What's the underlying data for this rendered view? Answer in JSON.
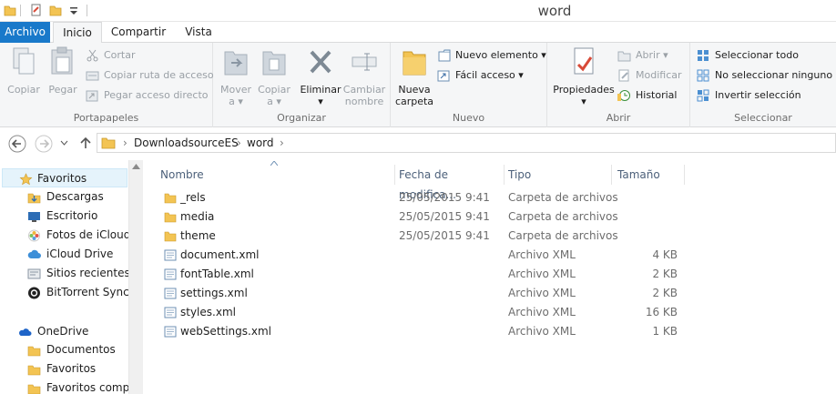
{
  "window": {
    "title": "word"
  },
  "ribbon_tabs": [
    "Archivo",
    "Inicio",
    "Compartir",
    "Vista"
  ],
  "ribbon": {
    "portapapeles": {
      "label": "Portapapeles",
      "copiar": "Copiar",
      "pegar": "Pegar",
      "cortar": "Cortar",
      "copiar_ruta": "Copiar ruta de acceso",
      "pegar_acceso": "Pegar acceso directo"
    },
    "organizar": {
      "label": "Organizar",
      "mover": "Mover",
      "mover2": "a",
      "copiar": "Copiar",
      "copiar2": "a",
      "eliminar": "Eliminar",
      "cambiar": "Cambiar",
      "cambiar2": "nombre"
    },
    "nuevo": {
      "label": "Nuevo",
      "nueva": "Nueva",
      "carpeta": "carpeta",
      "nuevo_elemento": "Nuevo elemento",
      "facil_acceso": "Fácil acceso"
    },
    "abrir": {
      "label": "Abrir",
      "propiedades": "Propiedades",
      "abrir": "Abrir",
      "modificar": "Modificar",
      "historial": "Historial"
    },
    "seleccionar": {
      "label": "Seleccionar",
      "todo": "Seleccionar todo",
      "ninguno": "No seleccionar ninguno",
      "invertir": "Invertir selección"
    }
  },
  "address": {
    "crumbs": [
      "DownloadsourceES",
      "word"
    ]
  },
  "nav": {
    "favoritos": "Favoritos",
    "items": [
      "Descargas",
      "Escritorio",
      "Fotos de iCloud",
      "iCloud Drive",
      "Sitios recientes",
      "BitTorrent Sync"
    ],
    "onedrive": "OneDrive",
    "onedrive_items": [
      "Documentos",
      "Favoritos",
      "Favoritos compa"
    ]
  },
  "columns": {
    "name": "Nombre",
    "date": "Fecha de modifica...",
    "type": "Tipo",
    "size": "Tamaño"
  },
  "files": [
    {
      "name": "_rels",
      "date": "25/05/2015 9:41",
      "type": "Carpeta de archivos",
      "size": "",
      "kind": "folder"
    },
    {
      "name": "media",
      "date": "25/05/2015 9:41",
      "type": "Carpeta de archivos",
      "size": "",
      "kind": "folder"
    },
    {
      "name": "theme",
      "date": "25/05/2015 9:41",
      "type": "Carpeta de archivos",
      "size": "",
      "kind": "folder"
    },
    {
      "name": "document.xml",
      "date": "",
      "type": "Archivo XML",
      "size": "4 KB",
      "kind": "xml"
    },
    {
      "name": "fontTable.xml",
      "date": "",
      "type": "Archivo XML",
      "size": "2 KB",
      "kind": "xml"
    },
    {
      "name": "settings.xml",
      "date": "",
      "type": "Archivo XML",
      "size": "2 KB",
      "kind": "xml"
    },
    {
      "name": "styles.xml",
      "date": "",
      "type": "Archivo XML",
      "size": "16 KB",
      "kind": "xml"
    },
    {
      "name": "webSettings.xml",
      "date": "",
      "type": "Archivo XML",
      "size": "1 KB",
      "kind": "xml"
    }
  ],
  "colors": {
    "accent": "#1979ca",
    "folder": "#f3c453",
    "header_text": "#4c607a"
  }
}
